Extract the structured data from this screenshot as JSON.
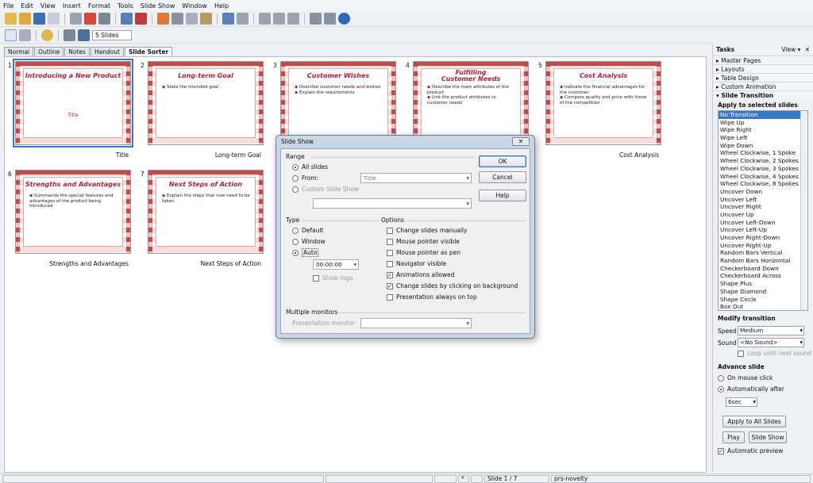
{
  "menu": [
    "File",
    "Edit",
    "View",
    "Insert",
    "Format",
    "Tools",
    "Slide Show",
    "Window",
    "Help"
  ],
  "toolbar2": {
    "slides_count": "5 Slides"
  },
  "view_tabs": [
    "Normal",
    "Outline",
    "Notes",
    "Handout",
    "Slide Sorter"
  ],
  "slides": [
    {
      "num": "1",
      "title": "Introducing a New Product",
      "bullets": [],
      "center": "Title",
      "caption": "Title"
    },
    {
      "num": "2",
      "title": "Long-term Goal",
      "bullets": [
        "State the intended goal"
      ],
      "caption": "Long-term Goal"
    },
    {
      "num": "3",
      "title": "Customer Wishes",
      "bullets": [
        "Describe customer needs and wishes",
        "Explain the requirements"
      ],
      "caption": ""
    },
    {
      "num": "4",
      "title": "Fulfilling Customer Needs",
      "bullets": [
        "Describe the main attributes of the product",
        "Link the product attributes to customer needs"
      ],
      "caption": ""
    },
    {
      "num": "5",
      "title": "Cost Analysis",
      "bullets": [
        "Indicate the financial advantages for the customer",
        "Compare quality and price with those of the competition"
      ],
      "caption": "Cost Analysis"
    },
    {
      "num": "6",
      "title": "Strengths and Advantages",
      "bullets": [
        "Summarize the special features and advantages of the product being introduced"
      ],
      "caption": "Strengths and Advantages"
    },
    {
      "num": "7",
      "title": "Next Steps of Action",
      "bullets": [
        "Explain the steps that now need to be taken"
      ],
      "caption": "Next Steps of Action"
    }
  ],
  "tasks": {
    "title": "Tasks",
    "view_label": "View",
    "sections": [
      "Master Pages",
      "Layouts",
      "Table Design",
      "Custom Animation",
      "Slide Transition"
    ],
    "apply_label": "Apply to selected slides",
    "transitions": [
      "No Transition",
      "Wipe Up",
      "Wipe Right",
      "Wipe Left",
      "Wipe Down",
      "Wheel Clockwise, 1 Spoke",
      "Wheel Clockwise, 2 Spokes",
      "Wheel Clockwise, 3 Spokes",
      "Wheel Clockwise, 4 Spokes",
      "Wheel Clockwise, 8 Spokes",
      "Uncover Down",
      "Uncover Left",
      "Uncover Right",
      "Uncover Up",
      "Uncover Left-Down",
      "Uncover Left-Up",
      "Uncover Right-Down",
      "Uncover Right-Up",
      "Random Bars Vertical",
      "Random Bars Horizontal",
      "Checkerboard Down",
      "Checkerboard Across",
      "Shape Plus",
      "Shape Diamond",
      "Shape Circle",
      "Box Out"
    ],
    "modify_label": "Modify transition",
    "speed_label": "Speed",
    "speed_value": "Medium",
    "sound_label": "Sound",
    "sound_value": "<No Sound>",
    "loop_label": "Loop until next sound",
    "advance_label": "Advance slide",
    "on_click_label": "On mouse click",
    "auto_after_label": "Automatically after",
    "auto_value": "6sec",
    "apply_all_label": "Apply to All Slides",
    "play_label": "Play",
    "slideshow_label": "Slide Show",
    "auto_preview_label": "Automatic preview"
  },
  "dialog": {
    "title": "Slide Show",
    "range_label": "Range",
    "all_slides": "All slides",
    "from_label": "From:",
    "from_value": "Title",
    "custom_label": "Custom Slide Show",
    "ok": "OK",
    "cancel": "Cancel",
    "help": "Help",
    "type_label": "Type",
    "type_default": "Default",
    "type_window": "Window",
    "type_auto": "Auto",
    "auto_time": "00:00:00",
    "show_logo": "Show logo",
    "options_label": "Options",
    "opt_change_manual": "Change slides manually",
    "opt_pointer_visible": "Mouse pointer visible",
    "opt_pointer_pen": "Mouse pointer as pen",
    "opt_navigator": "Navigator visible",
    "opt_animations": "Animations allowed",
    "opt_click_bg": "Change slides by clicking on background",
    "opt_on_top": "Presentation always on top",
    "monitors_label": "Multiple monitors",
    "pres_monitor": "Presentation monitor"
  },
  "status": {
    "star": "*",
    "slide": "Slide 1 / 7",
    "theme": "prs-novelty"
  }
}
